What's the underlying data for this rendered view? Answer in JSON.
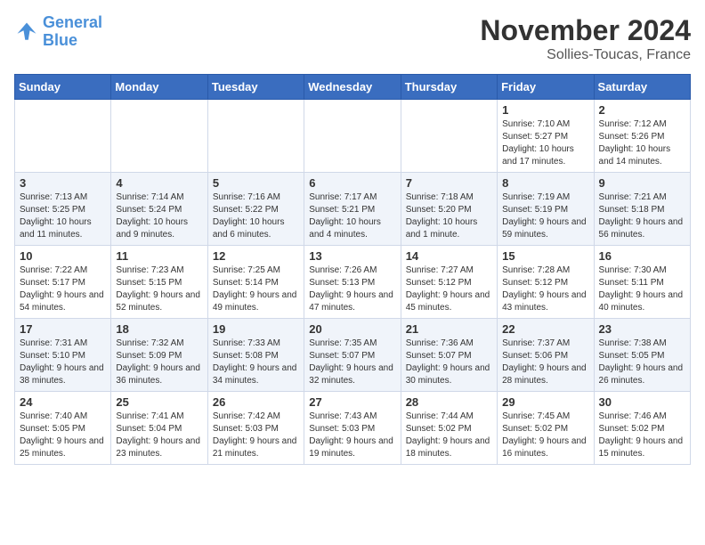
{
  "header": {
    "logo_line1": "General",
    "logo_line2": "Blue",
    "main_title": "November 2024",
    "subtitle": "Sollies-Toucas, France"
  },
  "days_of_week": [
    "Sunday",
    "Monday",
    "Tuesday",
    "Wednesday",
    "Thursday",
    "Friday",
    "Saturday"
  ],
  "weeks": [
    [
      {
        "day": "",
        "info": ""
      },
      {
        "day": "",
        "info": ""
      },
      {
        "day": "",
        "info": ""
      },
      {
        "day": "",
        "info": ""
      },
      {
        "day": "",
        "info": ""
      },
      {
        "day": "1",
        "info": "Sunrise: 7:10 AM\nSunset: 5:27 PM\nDaylight: 10 hours and 17 minutes."
      },
      {
        "day": "2",
        "info": "Sunrise: 7:12 AM\nSunset: 5:26 PM\nDaylight: 10 hours and 14 minutes."
      }
    ],
    [
      {
        "day": "3",
        "info": "Sunrise: 7:13 AM\nSunset: 5:25 PM\nDaylight: 10 hours and 11 minutes."
      },
      {
        "day": "4",
        "info": "Sunrise: 7:14 AM\nSunset: 5:24 PM\nDaylight: 10 hours and 9 minutes."
      },
      {
        "day": "5",
        "info": "Sunrise: 7:16 AM\nSunset: 5:22 PM\nDaylight: 10 hours and 6 minutes."
      },
      {
        "day": "6",
        "info": "Sunrise: 7:17 AM\nSunset: 5:21 PM\nDaylight: 10 hours and 4 minutes."
      },
      {
        "day": "7",
        "info": "Sunrise: 7:18 AM\nSunset: 5:20 PM\nDaylight: 10 hours and 1 minute."
      },
      {
        "day": "8",
        "info": "Sunrise: 7:19 AM\nSunset: 5:19 PM\nDaylight: 9 hours and 59 minutes."
      },
      {
        "day": "9",
        "info": "Sunrise: 7:21 AM\nSunset: 5:18 PM\nDaylight: 9 hours and 56 minutes."
      }
    ],
    [
      {
        "day": "10",
        "info": "Sunrise: 7:22 AM\nSunset: 5:17 PM\nDaylight: 9 hours and 54 minutes."
      },
      {
        "day": "11",
        "info": "Sunrise: 7:23 AM\nSunset: 5:15 PM\nDaylight: 9 hours and 52 minutes."
      },
      {
        "day": "12",
        "info": "Sunrise: 7:25 AM\nSunset: 5:14 PM\nDaylight: 9 hours and 49 minutes."
      },
      {
        "day": "13",
        "info": "Sunrise: 7:26 AM\nSunset: 5:13 PM\nDaylight: 9 hours and 47 minutes."
      },
      {
        "day": "14",
        "info": "Sunrise: 7:27 AM\nSunset: 5:12 PM\nDaylight: 9 hours and 45 minutes."
      },
      {
        "day": "15",
        "info": "Sunrise: 7:28 AM\nSunset: 5:12 PM\nDaylight: 9 hours and 43 minutes."
      },
      {
        "day": "16",
        "info": "Sunrise: 7:30 AM\nSunset: 5:11 PM\nDaylight: 9 hours and 40 minutes."
      }
    ],
    [
      {
        "day": "17",
        "info": "Sunrise: 7:31 AM\nSunset: 5:10 PM\nDaylight: 9 hours and 38 minutes."
      },
      {
        "day": "18",
        "info": "Sunrise: 7:32 AM\nSunset: 5:09 PM\nDaylight: 9 hours and 36 minutes."
      },
      {
        "day": "19",
        "info": "Sunrise: 7:33 AM\nSunset: 5:08 PM\nDaylight: 9 hours and 34 minutes."
      },
      {
        "day": "20",
        "info": "Sunrise: 7:35 AM\nSunset: 5:07 PM\nDaylight: 9 hours and 32 minutes."
      },
      {
        "day": "21",
        "info": "Sunrise: 7:36 AM\nSunset: 5:07 PM\nDaylight: 9 hours and 30 minutes."
      },
      {
        "day": "22",
        "info": "Sunrise: 7:37 AM\nSunset: 5:06 PM\nDaylight: 9 hours and 28 minutes."
      },
      {
        "day": "23",
        "info": "Sunrise: 7:38 AM\nSunset: 5:05 PM\nDaylight: 9 hours and 26 minutes."
      }
    ],
    [
      {
        "day": "24",
        "info": "Sunrise: 7:40 AM\nSunset: 5:05 PM\nDaylight: 9 hours and 25 minutes."
      },
      {
        "day": "25",
        "info": "Sunrise: 7:41 AM\nSunset: 5:04 PM\nDaylight: 9 hours and 23 minutes."
      },
      {
        "day": "26",
        "info": "Sunrise: 7:42 AM\nSunset: 5:03 PM\nDaylight: 9 hours and 21 minutes."
      },
      {
        "day": "27",
        "info": "Sunrise: 7:43 AM\nSunset: 5:03 PM\nDaylight: 9 hours and 19 minutes."
      },
      {
        "day": "28",
        "info": "Sunrise: 7:44 AM\nSunset: 5:02 PM\nDaylight: 9 hours and 18 minutes."
      },
      {
        "day": "29",
        "info": "Sunrise: 7:45 AM\nSunset: 5:02 PM\nDaylight: 9 hours and 16 minutes."
      },
      {
        "day": "30",
        "info": "Sunrise: 7:46 AM\nSunset: 5:02 PM\nDaylight: 9 hours and 15 minutes."
      }
    ]
  ]
}
